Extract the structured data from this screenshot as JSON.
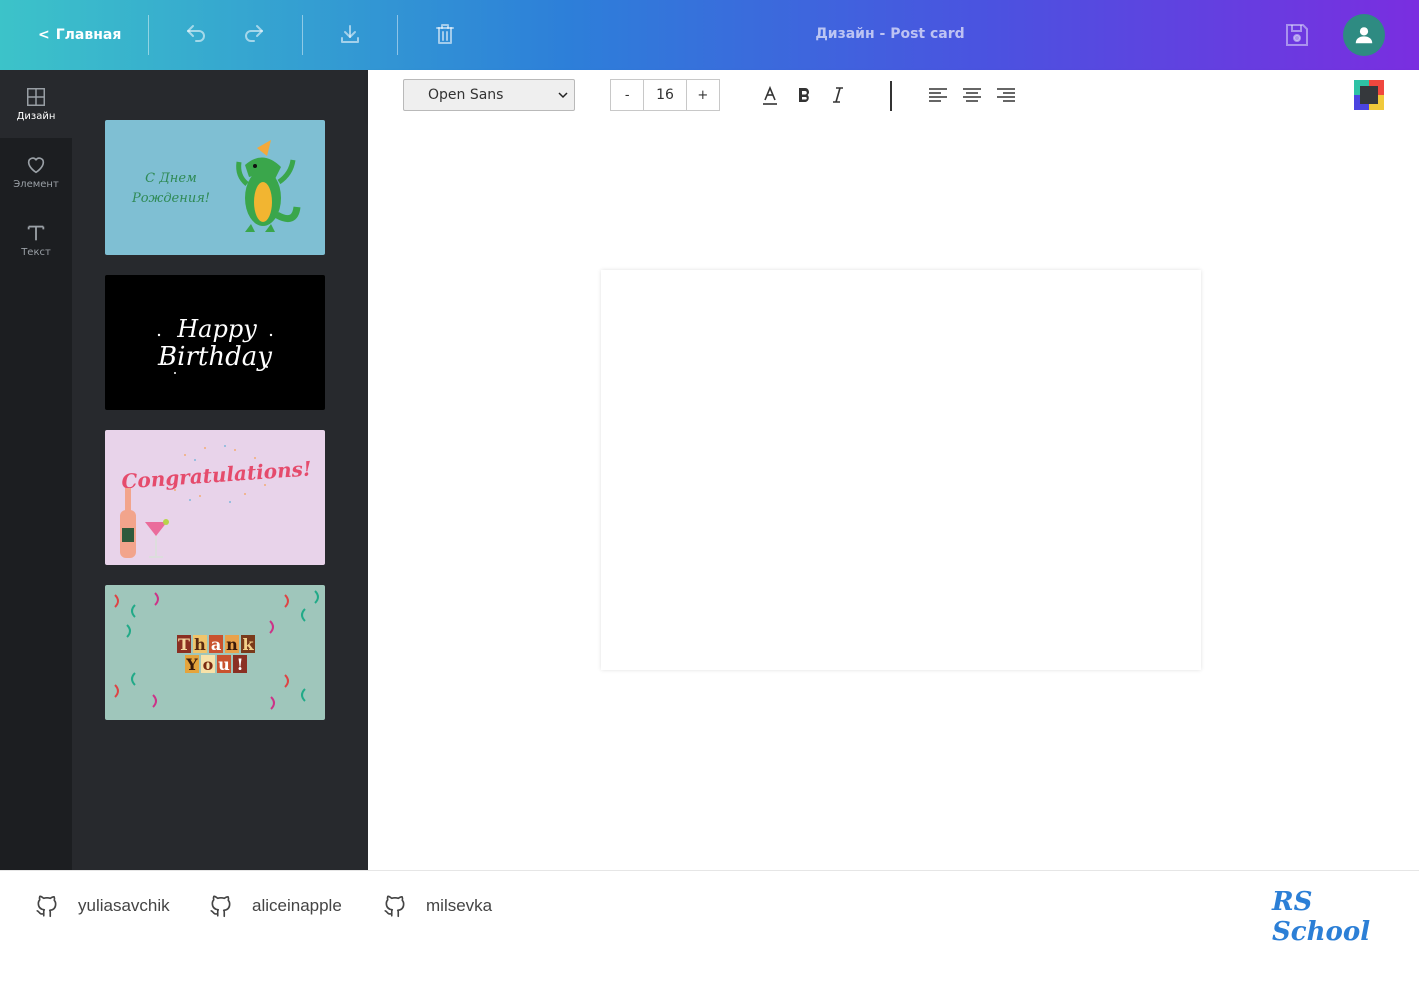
{
  "header": {
    "home_label": "Главная",
    "home_chevron": "<",
    "title": "Дизайн - Post card",
    "icons": [
      "undo-icon",
      "redo-icon",
      "download-icon",
      "trash-icon",
      "save-icon",
      "user-icon"
    ]
  },
  "rail": {
    "items": [
      {
        "label": "Дизайн",
        "icon": "layout-grid-icon",
        "active": true
      },
      {
        "label": "Элемент",
        "icon": "heart-icon",
        "active": false
      },
      {
        "label": "Текст",
        "icon": "text-t-icon",
        "active": false
      }
    ]
  },
  "templates": [
    {
      "name": "birthday-crocodile",
      "text": "С Днем Рождения!",
      "bg": "#7fbfd3"
    },
    {
      "name": "happy-birthday-black",
      "text": "Happy Birthday",
      "bg": "#000000"
    },
    {
      "name": "congratulations-pink",
      "text": "Congratulations!",
      "bg": "#e8d3ea"
    },
    {
      "name": "thank-you-green",
      "text": "Thank You!",
      "bg": "#9fc6bb"
    }
  ],
  "panel": {
    "collapse_label": "<"
  },
  "toolbar": {
    "font": "Open Sans",
    "font_size": "16",
    "minus": "-",
    "plus": "+",
    "icons": [
      "font-color-icon",
      "bold-icon",
      "italic-icon",
      "align-left-icon",
      "align-center-icon",
      "align-right-icon",
      "color-picker-icon"
    ]
  },
  "footer": {
    "contributors": [
      "yuliasavchik",
      "aliceinapple",
      "milsevka"
    ],
    "logo": "RS School"
  },
  "colors": {
    "accent_start": "#3cc3c9",
    "accent_end": "#7a2ee0",
    "avatar": "#2e8b82",
    "sidebar": "#27292d",
    "rail": "#1c1e21"
  }
}
